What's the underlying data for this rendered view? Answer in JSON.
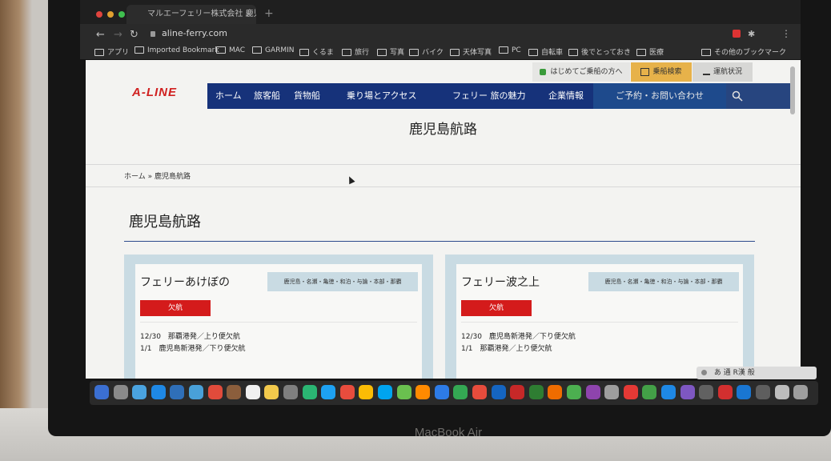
{
  "browser": {
    "tab_title": "マルエーフェリー株式会社 鹿児",
    "tab_close": "×",
    "new_tab": "+",
    "url": "aline-ferry.com",
    "bookmarks": [
      {
        "label": "アプリ",
        "icon": "apps-icon"
      },
      {
        "label": "Imported Bookmark",
        "icon": "folder-icon"
      },
      {
        "label": "MAC",
        "icon": "folder-icon"
      },
      {
        "label": "GARMIN",
        "icon": "folder-icon"
      },
      {
        "label": "くるま",
        "icon": "folder-icon"
      },
      {
        "label": "旅行",
        "icon": "folder-icon"
      },
      {
        "label": "写真",
        "icon": "folder-icon"
      },
      {
        "label": "バイク",
        "icon": "folder-icon"
      },
      {
        "label": "天体写真",
        "icon": "folder-icon"
      },
      {
        "label": "PC",
        "icon": "folder-icon"
      },
      {
        "label": "自転車",
        "icon": "folder-icon"
      },
      {
        "label": "後でとっておき",
        "icon": "folder-icon"
      },
      {
        "label": "医療",
        "icon": "folder-icon"
      },
      {
        "label": "その他のブックマーク",
        "icon": "folder-icon"
      }
    ]
  },
  "site": {
    "logo": "A-LINE",
    "utility": {
      "first_time": "はじめてご乗船の方へ",
      "search_schedule": "乗船検索",
      "operation_status": "運航状況"
    },
    "nav": [
      "ホーム",
      "旅客船",
      "貨物船",
      "乗り場とアクセス",
      "フェリー 旅の魅力",
      "企業情報"
    ],
    "nav_contact": "ご予約・お問い合わせ",
    "hero_title": "鹿児島航路",
    "breadcrumb": "ホーム » 鹿児島航路",
    "section_title": "鹿児島航路"
  },
  "cards": [
    {
      "ship": "フェリーあけぼの",
      "route": "鹿児島・名瀬・亀徳・和泊・与論・本部・那覇",
      "status": "欠航",
      "schedule": [
        "12/30　那覇港発／上り便欠航",
        "1/1　鹿児島新港発／下り便欠航"
      ]
    },
    {
      "ship": "フェリー波之上",
      "route": "鹿児島・名瀬・亀徳・和泊・与論・本部・那覇",
      "status": "欠航",
      "schedule": [
        "12/30　鹿児島新港発／下り便欠航",
        "1/1　那覇港発／上り便欠航"
      ]
    }
  ],
  "ime": "あ 通 R漢 般",
  "device_label": "MacBook Air",
  "colors": {
    "nav_bg": "#16327a",
    "accent_red": "#d41b1b",
    "card_bg": "#c9dbe3",
    "logo_red": "#d02020"
  }
}
